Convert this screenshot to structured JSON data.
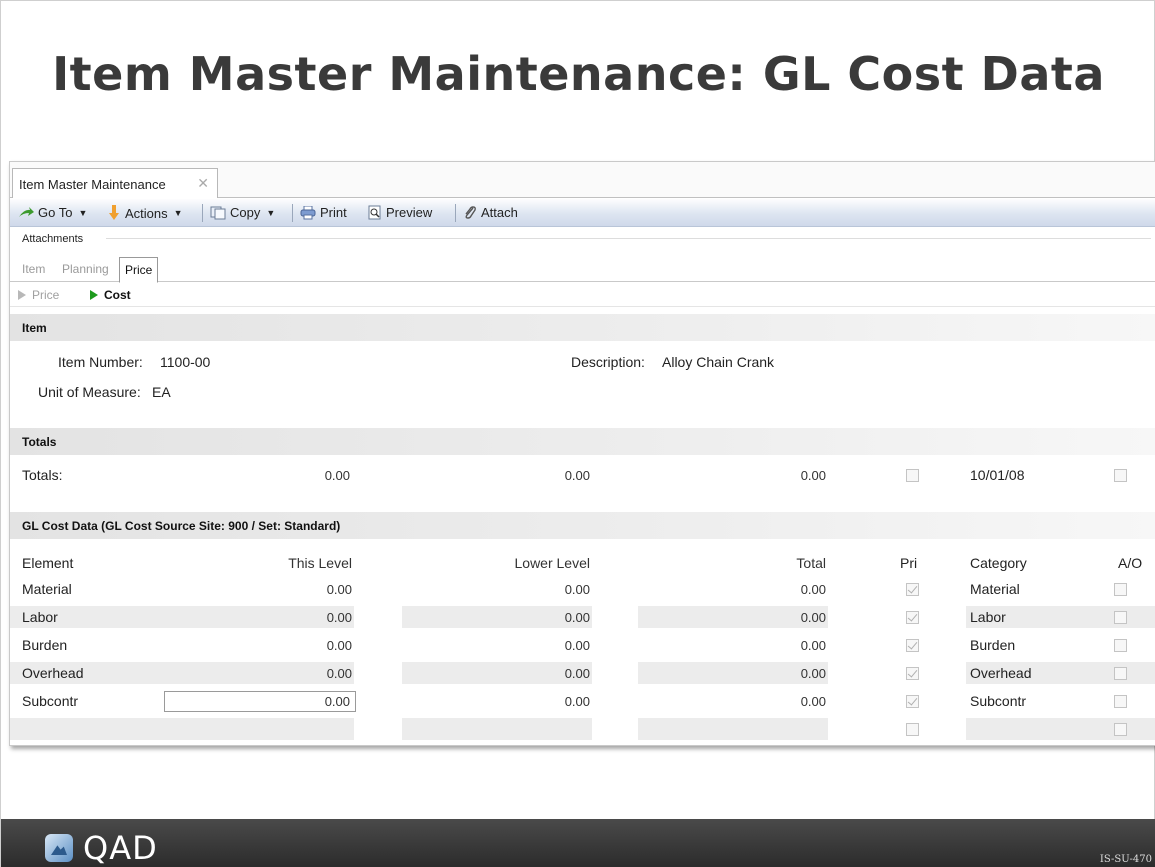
{
  "slide": {
    "title": "Item Master Maintenance: GL Cost Data",
    "code": "IS-SU-470",
    "logo_text": "QAD"
  },
  "window": {
    "tab_label": "Item Master Maintenance",
    "close_glyph": "✕"
  },
  "toolbar": {
    "goto": "Go To",
    "actions": "Actions",
    "copy": "Copy",
    "print": "Print",
    "preview": "Preview",
    "attach": "Attach",
    "icons": [
      "goto-arrow-icon",
      "actions-icon",
      "copy-icon",
      "print-icon",
      "preview-icon",
      "attach-paperclip-icon"
    ]
  },
  "attachments_label": "Attachments",
  "subtabs": [
    "Item",
    "Planning",
    "Price"
  ],
  "active_subtab": "Price",
  "crumbs": {
    "price": "Price",
    "cost": "Cost"
  },
  "item_section": {
    "header": "Item",
    "item_number_label": "Item Number:",
    "item_number": "1100-00",
    "description_label": "Description:",
    "description": "Alloy Chain Crank",
    "uom_label": "Unit of Measure:",
    "uom": "EA"
  },
  "totals_section": {
    "header": "Totals",
    "label": "Totals:",
    "this_level": "0.00",
    "lower_level": "0.00",
    "total": "0.00",
    "date": "10/01/08"
  },
  "gl_section": {
    "header": "GL Cost Data (GL Cost Source Site: 900 / Set: Standard)",
    "columns": {
      "element": "Element",
      "this_level": "This Level",
      "lower_level": "Lower Level",
      "total": "Total",
      "pri": "Pri",
      "category": "Category",
      "ao": "A/O"
    },
    "rows": [
      {
        "element": "Material",
        "this_level": "0.00",
        "lower_level": "0.00",
        "total": "0.00",
        "pri": true,
        "category": "Material",
        "ao": false
      },
      {
        "element": "Labor",
        "this_level": "0.00",
        "lower_level": "0.00",
        "total": "0.00",
        "pri": true,
        "category": "Labor",
        "ao": false
      },
      {
        "element": "Burden",
        "this_level": "0.00",
        "lower_level": "0.00",
        "total": "0.00",
        "pri": true,
        "category": "Burden",
        "ao": false
      },
      {
        "element": "Overhead",
        "this_level": "0.00",
        "lower_level": "0.00",
        "total": "0.00",
        "pri": true,
        "category": "Overhead",
        "ao": false
      },
      {
        "element": "Subcontr",
        "this_level": "0.00",
        "lower_level": "0.00",
        "total": "0.00",
        "pri": true,
        "category": "Subcontr",
        "ao": false
      }
    ]
  },
  "colors": {
    "toolbar_blue": "#dde5f1",
    "green_arrow": "#1d9a1d",
    "footer": "#2b2b2b"
  }
}
